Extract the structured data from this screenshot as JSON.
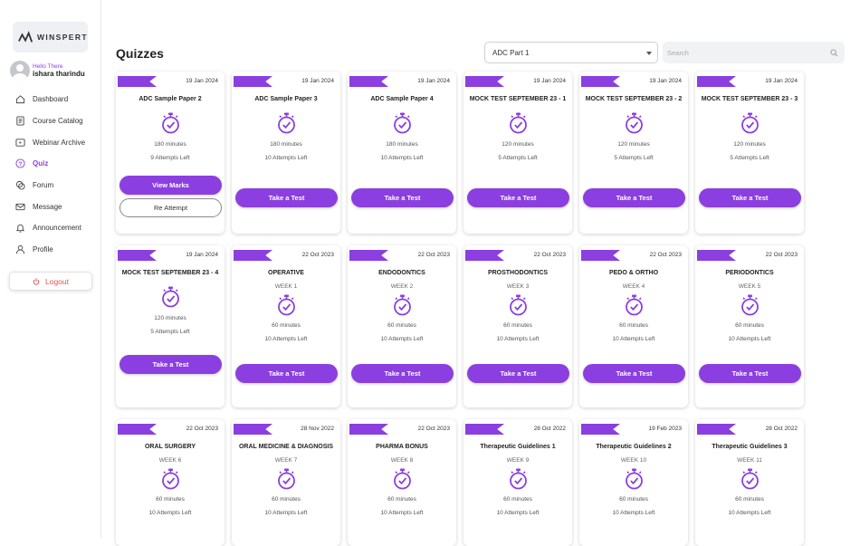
{
  "sidebar": {
    "logo": "WINSPERT",
    "greeting": "Hello There",
    "username": "ishara tharindu",
    "items": [
      {
        "label": "Dashboard",
        "icon": "home-icon"
      },
      {
        "label": "Course Catalog",
        "icon": "document-icon"
      },
      {
        "label": "Webinar Archive",
        "icon": "video-icon"
      },
      {
        "label": "Quiz",
        "icon": "question-icon",
        "active": true
      },
      {
        "label": "Forum",
        "icon": "forum-icon"
      },
      {
        "label": "Message",
        "icon": "mail-icon"
      },
      {
        "label": "Announcement",
        "icon": "bell-icon"
      },
      {
        "label": "Profile",
        "icon": "user-icon"
      }
    ],
    "logout": "Logout"
  },
  "header": {
    "title": "Quizzes",
    "select_value": "ADC Part 1",
    "search_placeholder": "Search"
  },
  "colors": {
    "accent": "#8b3fe0",
    "logout": "#e05353"
  },
  "quizzes": [
    {
      "date": "19 Jan 2024",
      "title": "ADC Sample Paper 2",
      "week": "",
      "minutes": "180 minutes",
      "attempts": "9 Attempts Left",
      "primary": "View Marks",
      "secondary": "Re Attempt"
    },
    {
      "date": "19 Jan 2024",
      "title": "ADC Sample Paper 3",
      "week": "",
      "minutes": "180 minutes",
      "attempts": "10 Attempts Left",
      "primary": "Take a Test"
    },
    {
      "date": "19 Jan 2024",
      "title": "ADC Sample Paper 4",
      "week": "",
      "minutes": "180 minutes",
      "attempts": "10 Attempts Left",
      "primary": "Take a Test"
    },
    {
      "date": "19 Jan 2024",
      "title": "MOCK TEST SEPTEMBER 23 - 1",
      "week": "",
      "minutes": "120 minutes",
      "attempts": "5 Attempts Left",
      "primary": "Take a Test"
    },
    {
      "date": "19 Jan 2024",
      "title": "MOCK TEST SEPTEMBER 23 - 2",
      "week": "",
      "minutes": "120 minutes",
      "attempts": "5 Attempts Left",
      "primary": "Take a Test"
    },
    {
      "date": "19 Jan 2024",
      "title": "MOCK TEST SEPTEMBER 23 - 3",
      "week": "",
      "minutes": "120 minutes",
      "attempts": "5 Attempts Left",
      "primary": "Take a Test"
    },
    {
      "date": "19 Jan 2024",
      "title": "MOCK TEST SEPTEMBER 23 - 4",
      "week": "",
      "minutes": "120 minutes",
      "attempts": "5 Attempts Left",
      "primary": "Take a Test"
    },
    {
      "date": "22 Oct 2023",
      "title": "OPERATIVE",
      "week": "WEEK 1",
      "minutes": "60 minutes",
      "attempts": "10 Attempts Left",
      "primary": "Take a Test"
    },
    {
      "date": "22 Oct 2023",
      "title": "ENDODONTICS",
      "week": "WEEK 2",
      "minutes": "60 minutes",
      "attempts": "10 Attempts Left",
      "primary": "Take a Test"
    },
    {
      "date": "22 Oct 2023",
      "title": "PROSTHODONTICS",
      "week": "WEEK 3",
      "minutes": "60 minutes",
      "attempts": "10 Attempts Left",
      "primary": "Take a Test"
    },
    {
      "date": "22 Oct 2023",
      "title": "PEDO & ORTHO",
      "week": "WEEK 4",
      "minutes": "60 minutes",
      "attempts": "10 Attempts Left",
      "primary": "Take a Test"
    },
    {
      "date": "22 Oct 2023",
      "title": "PERIODONTICS",
      "week": "WEEK 5",
      "minutes": "60 minutes",
      "attempts": "10 Attempts Left",
      "primary": "Take a Test"
    },
    {
      "date": "22 Oct 2023",
      "title": "ORAL SURGERY",
      "week": "WEEK 6",
      "minutes": "60 minutes",
      "attempts": "10 Attempts Left",
      "primary": ""
    },
    {
      "date": "28 Nov 2022",
      "title": "ORAL MEDICINE & DIAGNOSIS",
      "week": "WEEK 7",
      "minutes": "60 minutes",
      "attempts": "10 Attempts Left",
      "primary": ""
    },
    {
      "date": "22 Oct 2023",
      "title": "PHARMA BONUS",
      "week": "WEEK 8",
      "minutes": "60 minutes",
      "attempts": "10 Attempts Left",
      "primary": ""
    },
    {
      "date": "28 Oct 2022",
      "title": "Therapeutic Guidelines 1",
      "week": "WEEK 9",
      "minutes": "60 minutes",
      "attempts": "10 Attempts Left",
      "primary": ""
    },
    {
      "date": "19 Feb 2023",
      "title": "Therapeutic Guidelines 2",
      "week": "WEEK 10",
      "minutes": "60 minutes",
      "attempts": "10 Attempts Left",
      "primary": ""
    },
    {
      "date": "28 Oct 2022",
      "title": "Therapeutic Guidelines 3",
      "week": "WEEK 11",
      "minutes": "60 minutes",
      "attempts": "10 Attempts Left",
      "primary": ""
    }
  ]
}
